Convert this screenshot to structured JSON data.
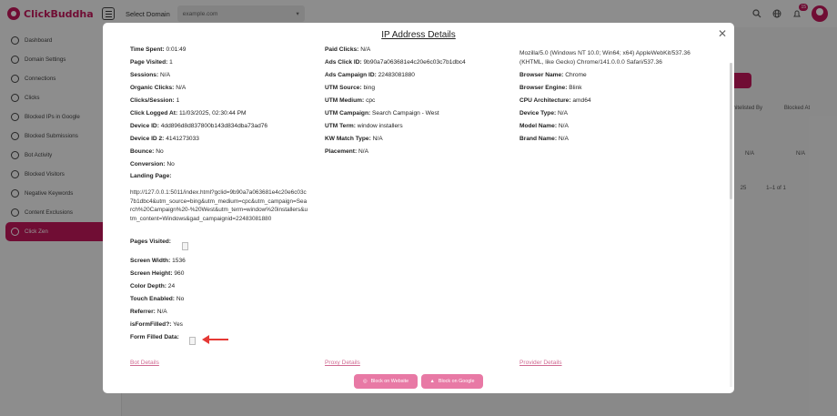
{
  "topbar": {
    "logo": "ClickBuddha",
    "domain_label": "Select Domain",
    "domain_value": "example.com",
    "notification_count": "15"
  },
  "sidebar": {
    "items": [
      {
        "label": "Dashboard",
        "icon": "dashboard-icon"
      },
      {
        "label": "Domain Settings",
        "icon": "settings-icon"
      },
      {
        "label": "Connections",
        "icon": "link-icon"
      },
      {
        "label": "Clicks",
        "icon": "click-icon"
      },
      {
        "label": "Blocked IPs in Google",
        "icon": "google-icon"
      },
      {
        "label": "Blocked Submissions",
        "icon": "block-icon"
      },
      {
        "label": "Bot Activity",
        "icon": "bot-icon"
      },
      {
        "label": "Blocked Visitors",
        "icon": "shield-icon"
      },
      {
        "label": "Negative Keywords",
        "icon": "keyword-icon"
      },
      {
        "label": "Content Exclusions",
        "icon": "warning-icon"
      },
      {
        "label": "Click Zen",
        "icon": "zen-icon",
        "active": true
      }
    ]
  },
  "background": {
    "col_whitelisted": "Whitelisted By",
    "col_blocked": "Blocked At",
    "cell1": "N/A",
    "cell2": "N/A",
    "per_page": "25",
    "range": "1–1 of 1"
  },
  "modal": {
    "title": "IP Address Details",
    "col1": {
      "time_spent": {
        "label": "Time Spent:",
        "value": "0:01:49"
      },
      "page_visited": {
        "label": "Page Visited:",
        "value": "1"
      },
      "sessions": {
        "label": "Sessions:",
        "value": "N/A"
      },
      "organic_clicks": {
        "label": "Organic Clicks:",
        "value": "N/A"
      },
      "clicks_session": {
        "label": "Clicks/Session:",
        "value": "1"
      },
      "click_logged": {
        "label": "Click Logged At:",
        "value": "11/03/2025, 02:30:44 PM"
      },
      "device_id": {
        "label": "Device ID:",
        "value": "4dd896d8d837800b143d834dba73ad76"
      },
      "device_id2": {
        "label": "Device ID 2:",
        "value": "4141273033"
      },
      "bounce": {
        "label": "Bounce:",
        "value": "No"
      },
      "conversion": {
        "label": "Conversion:",
        "value": "No"
      },
      "landing_page": {
        "label": "Landing Page:",
        "value": "http://127.0.0.1:5011/index.html?gclid=9b90a7a063681e4c20e6c03c7b1dbc4&utm_source=bing&utm_medium=cpc&utm_campaign=Search%20Campaign%20-%20West&utm_term=window%20installers&utm_content=Windows&gad_campaignid=22483081880"
      },
      "pages_visited": {
        "label": "Pages Visited:"
      },
      "screen_width": {
        "label": "Screen Width:",
        "value": "1536"
      },
      "screen_height": {
        "label": "Screen Height:",
        "value": "960"
      },
      "color_depth": {
        "label": "Color Depth:",
        "value": "24"
      },
      "touch_enabled": {
        "label": "Touch Enabled:",
        "value": "No"
      },
      "referrer": {
        "label": "Referrer:",
        "value": "N/A"
      },
      "is_form_filled": {
        "label": "isFormFilled?:",
        "value": "Yes"
      },
      "form_filled_data": {
        "label": "Form Filled Data:"
      }
    },
    "col2": {
      "paid_clicks": {
        "label": "Paid Clicks:",
        "value": "N/A"
      },
      "ads_click_id": {
        "label": "Ads Click ID:",
        "value": "9b90a7a063681e4c20e6c03c7b1dbc4"
      },
      "ads_campaign_id": {
        "label": "Ads Campaign ID:",
        "value": "22483081880"
      },
      "utm_source": {
        "label": "UTM Source:",
        "value": "bing"
      },
      "utm_medium": {
        "label": "UTM Medium:",
        "value": "cpc"
      },
      "utm_campaign": {
        "label": "UTM Campaign:",
        "value": "Search Campaign - West"
      },
      "utm_term": {
        "label": "UTM Term:",
        "value": "window installers"
      },
      "kw_match": {
        "label": "KW Match Type:",
        "value": "N/A"
      },
      "placement": {
        "label": "Placement:",
        "value": "N/A"
      }
    },
    "col3": {
      "user_agent": "Mozilla/5.0 (Windows NT 10.0; Win64; x64) AppleWebKit/537.36 (KHTML, like Gecko) Chrome/141.0.0.0 Safari/537.36",
      "browser_name": {
        "label": "Browser Name:",
        "value": "Chrome"
      },
      "browser_engine": {
        "label": "Browser Engine:",
        "value": "Blink"
      },
      "cpu_arch": {
        "label": "CPU Architecture:",
        "value": "amd64"
      },
      "device_type": {
        "label": "Device Type:",
        "value": "N/A"
      },
      "model_name": {
        "label": "Model Name:",
        "value": "N/A"
      },
      "brand_name": {
        "label": "Brand Name:",
        "value": "N/A"
      }
    },
    "links": {
      "bot": "Bot Details",
      "proxy": "Proxy Details",
      "provider": "Provider Details"
    },
    "buttons": {
      "block_website": "Block on Website",
      "block_google": "Block on Google"
    },
    "accent": "#c2185b",
    "arrow_color": "#e53935"
  }
}
